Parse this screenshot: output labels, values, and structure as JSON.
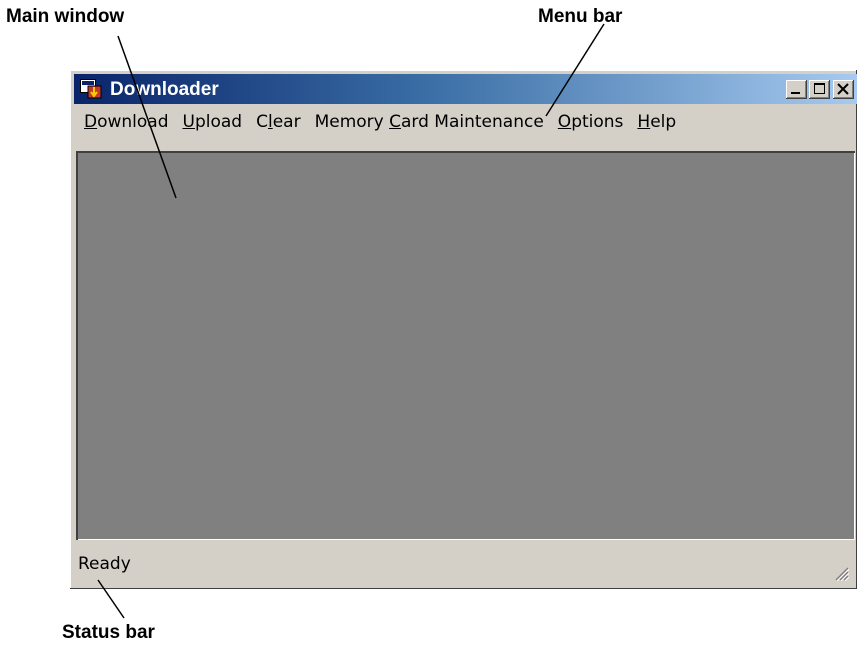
{
  "callouts": {
    "main_window": "Main window",
    "menu_bar": "Menu bar",
    "status_bar": "Status bar"
  },
  "window": {
    "title": "Downloader",
    "icon": "downloader-app-icon",
    "caption_buttons": [
      "minimize-icon",
      "maximize-icon",
      "close-icon"
    ]
  },
  "menu": {
    "items": [
      {
        "pre": "",
        "accel": "D",
        "post": "ownload"
      },
      {
        "pre": "",
        "accel": "U",
        "post": "pload"
      },
      {
        "pre": "C",
        "accel": "l",
        "post": "ear"
      },
      {
        "pre": "Memory ",
        "accel": "C",
        "post": "ard Maintenance"
      },
      {
        "pre": "",
        "accel": "O",
        "post": "ptions"
      },
      {
        "pre": "",
        "accel": "H",
        "post": "elp"
      }
    ]
  },
  "status": {
    "text": "Ready"
  },
  "colors": {
    "title_gradient_start": "#0a246a",
    "title_gradient_end": "#a6caf0",
    "chrome": "#d4d0c8",
    "client_area": "#808080"
  }
}
